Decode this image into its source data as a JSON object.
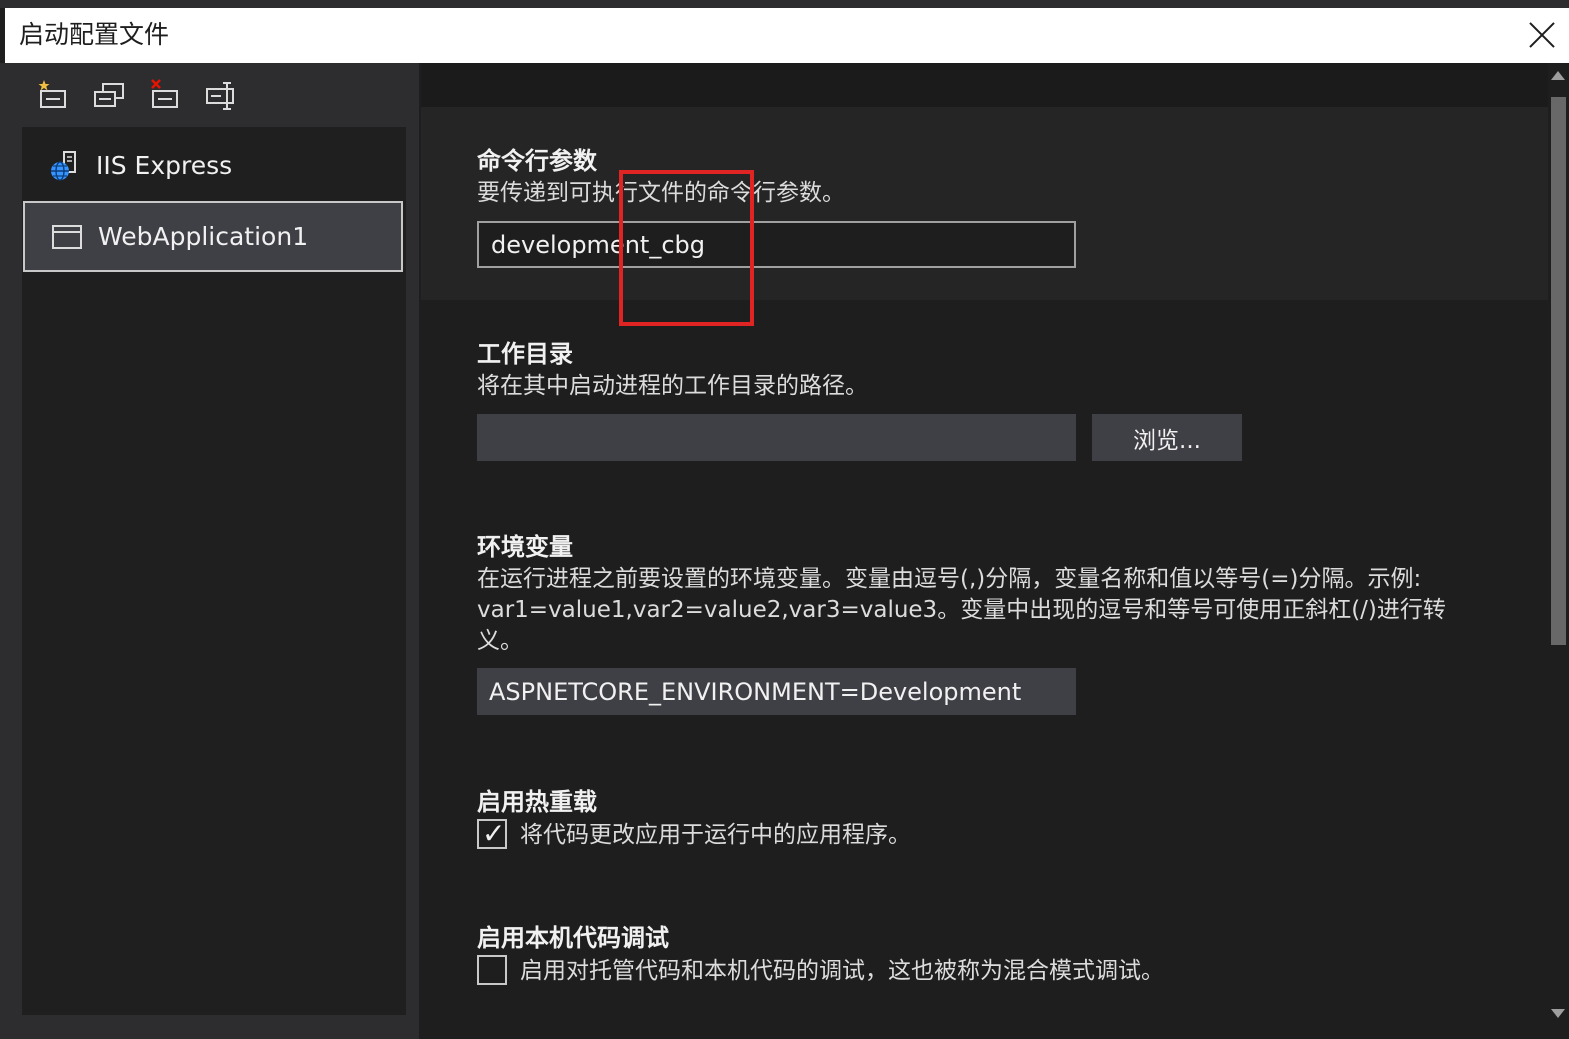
{
  "window": {
    "title": "启动配置文件"
  },
  "toolbar": {
    "icons": [
      "new-profile-icon",
      "copy-profile-icon",
      "delete-profile-icon",
      "rename-profile-icon"
    ]
  },
  "profiles": [
    {
      "label": "IIS Express",
      "icon": "globe-server-icon",
      "selected": false
    },
    {
      "label": "WebApplication1",
      "icon": "window-icon",
      "selected": true
    }
  ],
  "sections": {
    "cmdargs": {
      "title": "命令行参数",
      "desc": "要传递到可执行文件的命令行参数。",
      "value": "development_cbg"
    },
    "workdir": {
      "title": "工作目录",
      "desc": "将在其中启动进程的工作目录的路径。",
      "value": "",
      "browse_label": "浏览..."
    },
    "envvars": {
      "title": "环境变量",
      "desc_line1": "在运行进程之前要设置的环境变量。变量由逗号(,)分隔，变量名称和值以等号(=)分隔。示例:",
      "desc_line2": "var1=value1,var2=value2,var3=value3。变量中出现的逗号和等号可使用正斜杠(/)进行转",
      "desc_line3": "义。",
      "value": "ASPNETCORE_ENVIRONMENT=Development"
    },
    "hotreload": {
      "title": "启用热重载",
      "label": "将代码更改应用于运行中的应用程序。",
      "checked": true
    },
    "nativedebug": {
      "title": "启用本机代码调试",
      "label": "启用对托管代码和本机代码的调试，这也被称为混合模式调试。",
      "checked": false
    }
  },
  "colors": {
    "highlight_box": "#e02424",
    "accent_blue": "#3794ff"
  }
}
